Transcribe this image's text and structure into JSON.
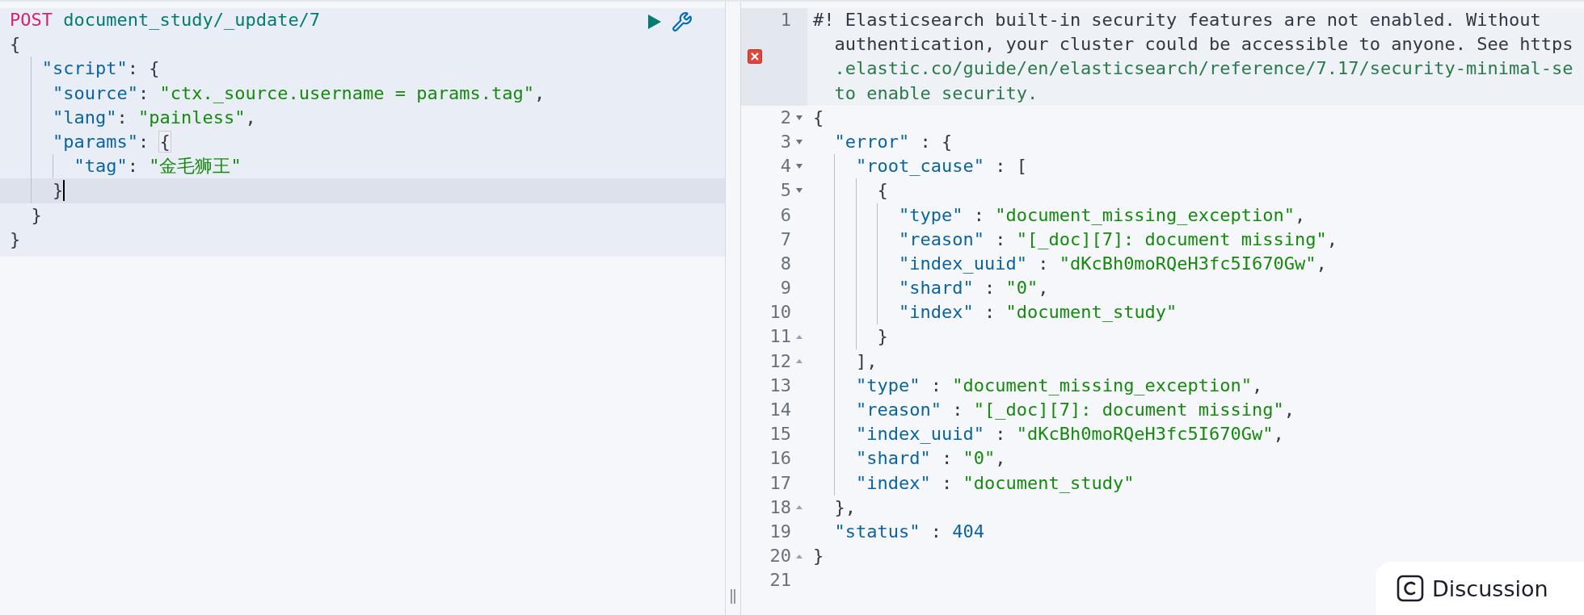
{
  "request_editor": {
    "lines": [
      {
        "active": false,
        "cursor": false,
        "tokens": [
          {
            "kind": "method",
            "text": "POST"
          },
          {
            "kind": "path",
            "text": " document_study/_update/7"
          }
        ]
      },
      {
        "active": false,
        "cursor": false,
        "tokens": [
          {
            "kind": "punct",
            "text": "{"
          }
        ]
      },
      {
        "active": false,
        "cursor": false,
        "tokens": [
          {
            "kind": "key",
            "text": "   \"script\""
          },
          {
            "kind": "punct",
            "text": ": {"
          }
        ]
      },
      {
        "active": false,
        "cursor": false,
        "tokens": [
          {
            "kind": "key",
            "text": "    \"source\""
          },
          {
            "kind": "punct",
            "text": ": "
          },
          {
            "kind": "string",
            "text": "\"ctx._source.username = params.tag\""
          },
          {
            "kind": "punct",
            "text": ","
          }
        ]
      },
      {
        "active": false,
        "cursor": false,
        "tokens": [
          {
            "kind": "key",
            "text": "    \"lang\""
          },
          {
            "kind": "punct",
            "text": ": "
          },
          {
            "kind": "string",
            "text": "\"painless\""
          },
          {
            "kind": "punct",
            "text": ","
          }
        ]
      },
      {
        "active": false,
        "cursor": false,
        "tokens": [
          {
            "kind": "key",
            "text": "    \"params\""
          },
          {
            "kind": "punct",
            "text": ": "
          },
          {
            "kind": "punct",
            "text": "{",
            "matched": true
          }
        ]
      },
      {
        "active": false,
        "cursor": false,
        "tokens": [
          {
            "kind": "key",
            "text": "      \"tag\""
          },
          {
            "kind": "punct",
            "text": ": "
          },
          {
            "kind": "string",
            "text": "\"金毛狮王\""
          }
        ]
      },
      {
        "active": true,
        "cursor": true,
        "tokens": [
          {
            "kind": "punct",
            "text": "    }"
          }
        ]
      },
      {
        "active": false,
        "cursor": false,
        "tokens": [
          {
            "kind": "punct",
            "text": "  }"
          }
        ]
      },
      {
        "active": false,
        "cursor": false,
        "tokens": [
          {
            "kind": "punct",
            "text": "}"
          }
        ]
      }
    ]
  },
  "response_viewer": {
    "lines": [
      {
        "number": "1",
        "active": true,
        "error": true,
        "fold_start": false,
        "fold_end": false,
        "rows": [
          [
            {
              "kind": "comment",
              "text": "#! Elasticsearch built-in security features are not enabled. Without"
            }
          ],
          [
            {
              "kind": "comment",
              "text": "authentication, your cluster could be accessible to anyone. See https"
            }
          ],
          [
            {
              "kind": "link",
              "text": ".elastic.co/guide/en/elasticsearch/reference/7.17/security-minimal-se"
            }
          ],
          [
            {
              "kind": "link",
              "text": "to enable security."
            }
          ]
        ]
      },
      {
        "number": "2",
        "active": false,
        "error": false,
        "fold_start": true,
        "fold_end": false,
        "tokens": [
          {
            "kind": "punct",
            "text": "{"
          }
        ]
      },
      {
        "number": "3",
        "active": false,
        "error": false,
        "fold_start": true,
        "fold_end": false,
        "tokens": [
          {
            "kind": "key",
            "text": "  \"error\""
          },
          {
            "kind": "punct",
            "text": " : {"
          }
        ]
      },
      {
        "number": "4",
        "active": false,
        "error": false,
        "fold_start": true,
        "fold_end": false,
        "tokens": [
          {
            "kind": "key",
            "text": "    \"root_cause\""
          },
          {
            "kind": "punct",
            "text": " : ["
          }
        ]
      },
      {
        "number": "5",
        "active": false,
        "error": false,
        "fold_start": true,
        "fold_end": false,
        "tokens": [
          {
            "kind": "punct",
            "text": "      {"
          }
        ]
      },
      {
        "number": "6",
        "active": false,
        "error": false,
        "fold_start": false,
        "fold_end": false,
        "tokens": [
          {
            "kind": "key",
            "text": "        \"type\""
          },
          {
            "kind": "punct",
            "text": " : "
          },
          {
            "kind": "string",
            "text": "\"document_missing_exception\""
          },
          {
            "kind": "punct",
            "text": ","
          }
        ]
      },
      {
        "number": "7",
        "active": false,
        "error": false,
        "fold_start": false,
        "fold_end": false,
        "tokens": [
          {
            "kind": "key",
            "text": "        \"reason\""
          },
          {
            "kind": "punct",
            "text": " : "
          },
          {
            "kind": "string",
            "text": "\"[_doc][7]: document missing\""
          },
          {
            "kind": "punct",
            "text": ","
          }
        ]
      },
      {
        "number": "8",
        "active": false,
        "error": false,
        "fold_start": false,
        "fold_end": false,
        "tokens": [
          {
            "kind": "key",
            "text": "        \"index_uuid\""
          },
          {
            "kind": "punct",
            "text": " : "
          },
          {
            "kind": "string",
            "text": "\"dKcBh0moRQeH3fc5I670Gw\""
          },
          {
            "kind": "punct",
            "text": ","
          }
        ]
      },
      {
        "number": "9",
        "active": false,
        "error": false,
        "fold_start": false,
        "fold_end": false,
        "tokens": [
          {
            "kind": "key",
            "text": "        \"shard\""
          },
          {
            "kind": "punct",
            "text": " : "
          },
          {
            "kind": "string",
            "text": "\"0\""
          },
          {
            "kind": "punct",
            "text": ","
          }
        ]
      },
      {
        "number": "10",
        "active": false,
        "error": false,
        "fold_start": false,
        "fold_end": false,
        "tokens": [
          {
            "kind": "key",
            "text": "        \"index\""
          },
          {
            "kind": "punct",
            "text": " : "
          },
          {
            "kind": "string",
            "text": "\"document_study\""
          }
        ]
      },
      {
        "number": "11",
        "active": false,
        "error": false,
        "fold_start": false,
        "fold_end": true,
        "tokens": [
          {
            "kind": "punct",
            "text": "      }"
          }
        ]
      },
      {
        "number": "12",
        "active": false,
        "error": false,
        "fold_start": false,
        "fold_end": true,
        "tokens": [
          {
            "kind": "punct",
            "text": "    ],"
          }
        ]
      },
      {
        "number": "13",
        "active": false,
        "error": false,
        "fold_start": false,
        "fold_end": false,
        "tokens": [
          {
            "kind": "key",
            "text": "    \"type\""
          },
          {
            "kind": "punct",
            "text": " : "
          },
          {
            "kind": "string",
            "text": "\"document_missing_exception\""
          },
          {
            "kind": "punct",
            "text": ","
          }
        ]
      },
      {
        "number": "14",
        "active": false,
        "error": false,
        "fold_start": false,
        "fold_end": false,
        "tokens": [
          {
            "kind": "key",
            "text": "    \"reason\""
          },
          {
            "kind": "punct",
            "text": " : "
          },
          {
            "kind": "string",
            "text": "\"[_doc][7]: document missing\""
          },
          {
            "kind": "punct",
            "text": ","
          }
        ]
      },
      {
        "number": "15",
        "active": false,
        "error": false,
        "fold_start": false,
        "fold_end": false,
        "tokens": [
          {
            "kind": "key",
            "text": "    \"index_uuid\""
          },
          {
            "kind": "punct",
            "text": " : "
          },
          {
            "kind": "string",
            "text": "\"dKcBh0moRQeH3fc5I670Gw\""
          },
          {
            "kind": "punct",
            "text": ","
          }
        ]
      },
      {
        "number": "16",
        "active": false,
        "error": false,
        "fold_start": false,
        "fold_end": false,
        "tokens": [
          {
            "kind": "key",
            "text": "    \"shard\""
          },
          {
            "kind": "punct",
            "text": " : "
          },
          {
            "kind": "string",
            "text": "\"0\""
          },
          {
            "kind": "punct",
            "text": ","
          }
        ]
      },
      {
        "number": "17",
        "active": false,
        "error": false,
        "fold_start": false,
        "fold_end": false,
        "tokens": [
          {
            "kind": "key",
            "text": "    \"index\""
          },
          {
            "kind": "punct",
            "text": " : "
          },
          {
            "kind": "string",
            "text": "\"document_study\""
          }
        ]
      },
      {
        "number": "18",
        "active": false,
        "error": false,
        "fold_start": false,
        "fold_end": true,
        "tokens": [
          {
            "kind": "punct",
            "text": "  },"
          }
        ]
      },
      {
        "number": "19",
        "active": false,
        "error": false,
        "fold_start": false,
        "fold_end": false,
        "tokens": [
          {
            "kind": "key",
            "text": "  \"status\""
          },
          {
            "kind": "punct",
            "text": " : "
          },
          {
            "kind": "number",
            "text": "404"
          }
        ]
      },
      {
        "number": "20",
        "active": false,
        "error": false,
        "fold_start": false,
        "fold_end": true,
        "tokens": [
          {
            "kind": "punct",
            "text": "}"
          }
        ]
      },
      {
        "number": "21",
        "active": false,
        "error": false,
        "fold_start": false,
        "fold_end": false
      }
    ]
  },
  "discussion_button": {
    "label": "Discussion"
  }
}
